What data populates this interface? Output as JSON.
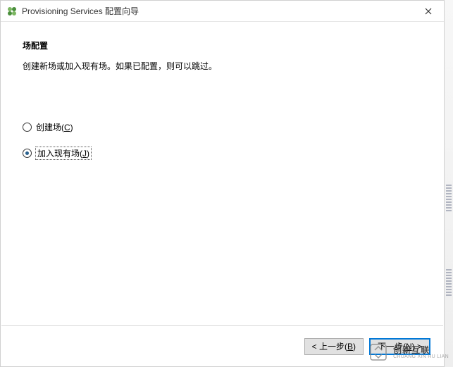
{
  "title": "Provisioning Services 配置向导",
  "content": {
    "heading": "场配置",
    "description": "创建新场或加入现有场。如果已配置，则可以跳过。"
  },
  "options": {
    "create": {
      "label": "创建场(",
      "hotkey": "C",
      "suffix": ")"
    },
    "join": {
      "label": "加入现有场(",
      "hotkey": "J",
      "suffix": ")"
    },
    "selected": "join"
  },
  "buttons": {
    "back_prefix": "< 上一步(",
    "back_hotkey": "B",
    "back_suffix": ")",
    "next_prefix": "下一步(",
    "next_hotkey": "N",
    "next_suffix": ") >"
  },
  "watermark": {
    "cn": "创新互联",
    "en": "CHUANG XIN HU LIAN"
  }
}
